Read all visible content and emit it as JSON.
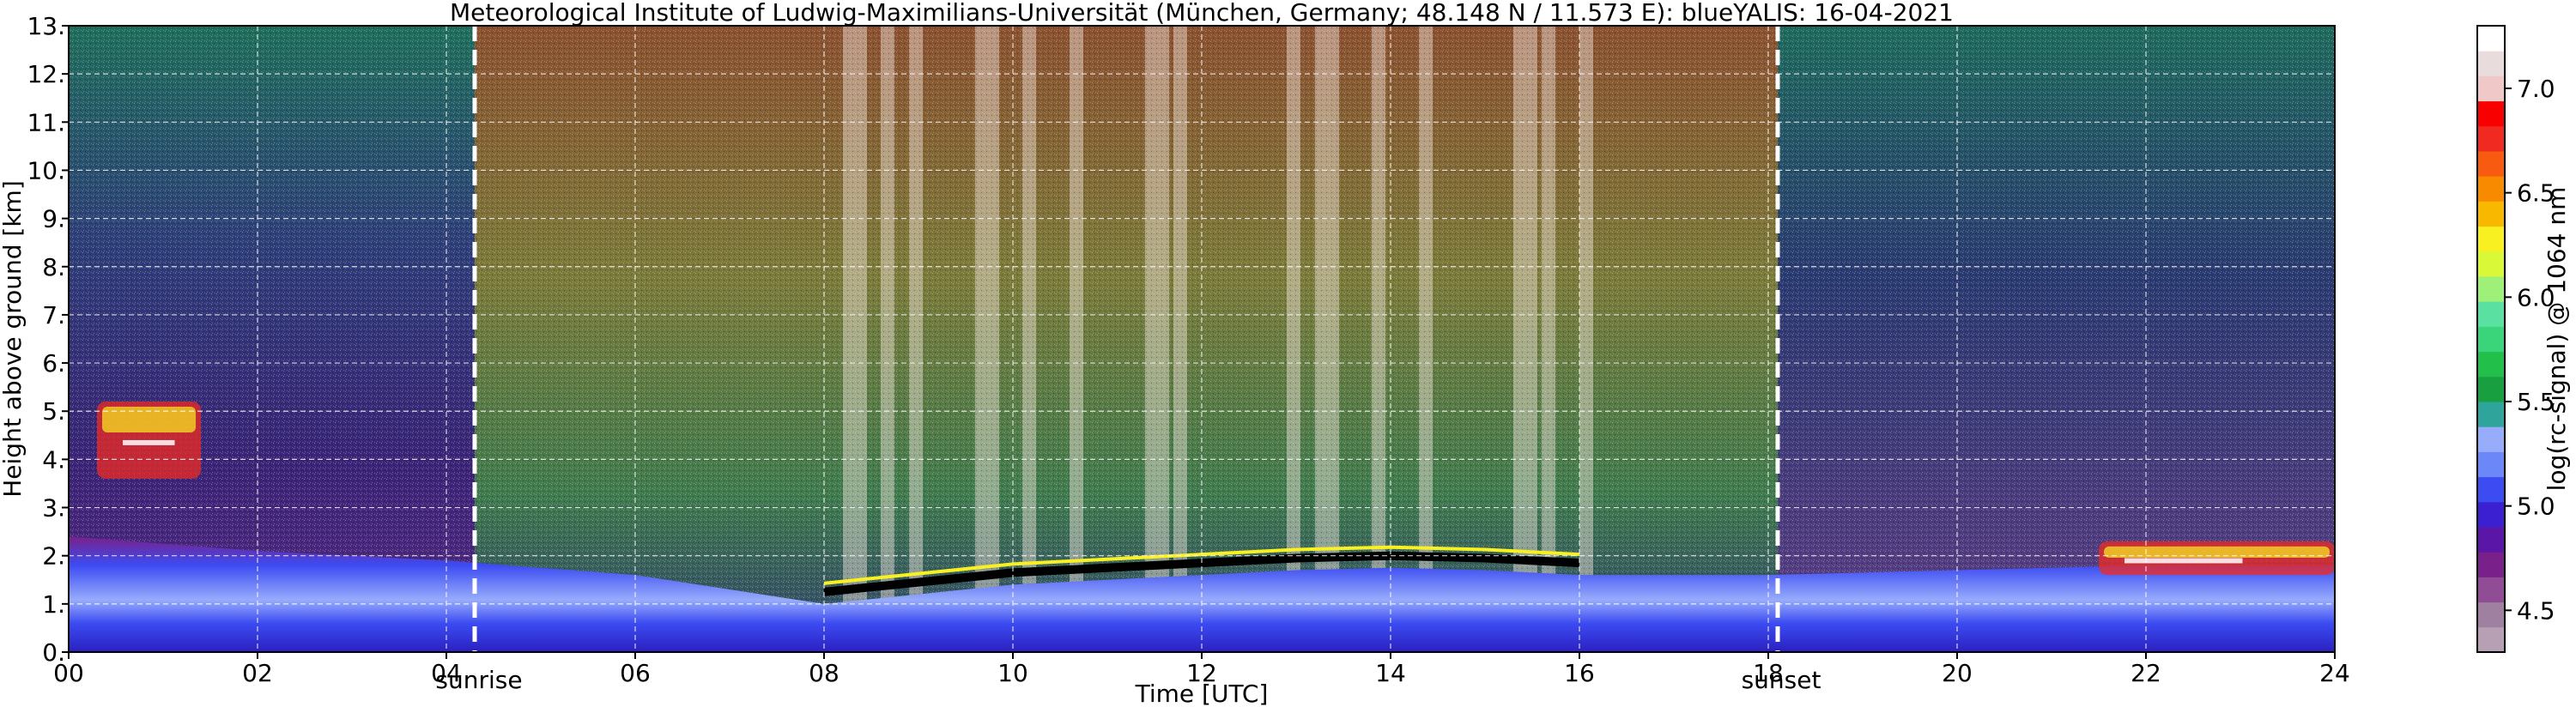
{
  "chart_data": {
    "type": "heatmap",
    "title": "Meteorological Institute of Ludwig-Maximilians-Universität (München, Germany; 48.148 N / 11.573 E):    blueYALIS: 16-04-2021",
    "xlabel": "Time [UTC]",
    "ylabel": "Height above ground [km]",
    "xlim": [
      0,
      24
    ],
    "ylim": [
      0,
      13
    ],
    "x_ticks": [
      "00",
      "02",
      "04",
      "06",
      "08",
      "10",
      "12",
      "14",
      "16",
      "18",
      "20",
      "22",
      "24"
    ],
    "y_ticks": [
      "0.",
      "1.",
      "2.",
      "3.",
      "4.",
      "5.",
      "6.",
      "7.",
      "8.",
      "9.",
      "10.",
      "11.",
      "12.",
      "13."
    ],
    "grid": true,
    "annotations": [
      {
        "label": "sunrise",
        "x": 4.3
      },
      {
        "label": "sunset",
        "x": 18.1
      }
    ],
    "colorbar": {
      "label": "log(rc-signal) @ 1064 nm",
      "ticks": [
        "4.5",
        "5.0",
        "5.5",
        "6.0",
        "6.5",
        "7.0"
      ],
      "range": [
        4.3,
        7.3
      ],
      "colors": [
        "#b8a0b4",
        "#a080a0",
        "#904c94",
        "#7a208a",
        "#5a16a6",
        "#3a20d0",
        "#3c4cf2",
        "#6c88f8",
        "#98acfc",
        "#2ea49a",
        "#18a040",
        "#22c04a",
        "#3ad47a",
        "#5ae0a0",
        "#9ef078",
        "#d8f838",
        "#f8f020",
        "#f8b800",
        "#f88a00",
        "#f85a10",
        "#f02a20",
        "#f80000",
        "#f0c8c8",
        "#e8dcdc",
        "#ffffff"
      ]
    },
    "layers": {
      "boundary_layer_top_km": [
        {
          "x": 0.0,
          "y": 2.4
        },
        {
          "x": 2.0,
          "y": 2.1
        },
        {
          "x": 4.0,
          "y": 1.9
        },
        {
          "x": 6.0,
          "y": 1.6
        },
        {
          "x": 8.0,
          "y": 1.0
        },
        {
          "x": 9.0,
          "y": 1.2
        },
        {
          "x": 10.0,
          "y": 1.4
        },
        {
          "x": 11.0,
          "y": 1.5
        },
        {
          "x": 12.0,
          "y": 1.6
        },
        {
          "x": 13.0,
          "y": 1.7
        },
        {
          "x": 14.0,
          "y": 1.75
        },
        {
          "x": 15.0,
          "y": 1.7
        },
        {
          "x": 16.0,
          "y": 1.6
        },
        {
          "x": 18.0,
          "y": 1.6
        },
        {
          "x": 20.0,
          "y": 1.7
        },
        {
          "x": 22.0,
          "y": 1.8
        },
        {
          "x": 24.0,
          "y": 1.8
        }
      ],
      "clouds": [
        {
          "x0": 0.3,
          "x1": 1.4,
          "y0": 3.6,
          "y1": 5.2
        },
        {
          "x0": 21.5,
          "x1": 24.0,
          "y0": 1.6,
          "y1": 2.3
        }
      ]
    }
  }
}
